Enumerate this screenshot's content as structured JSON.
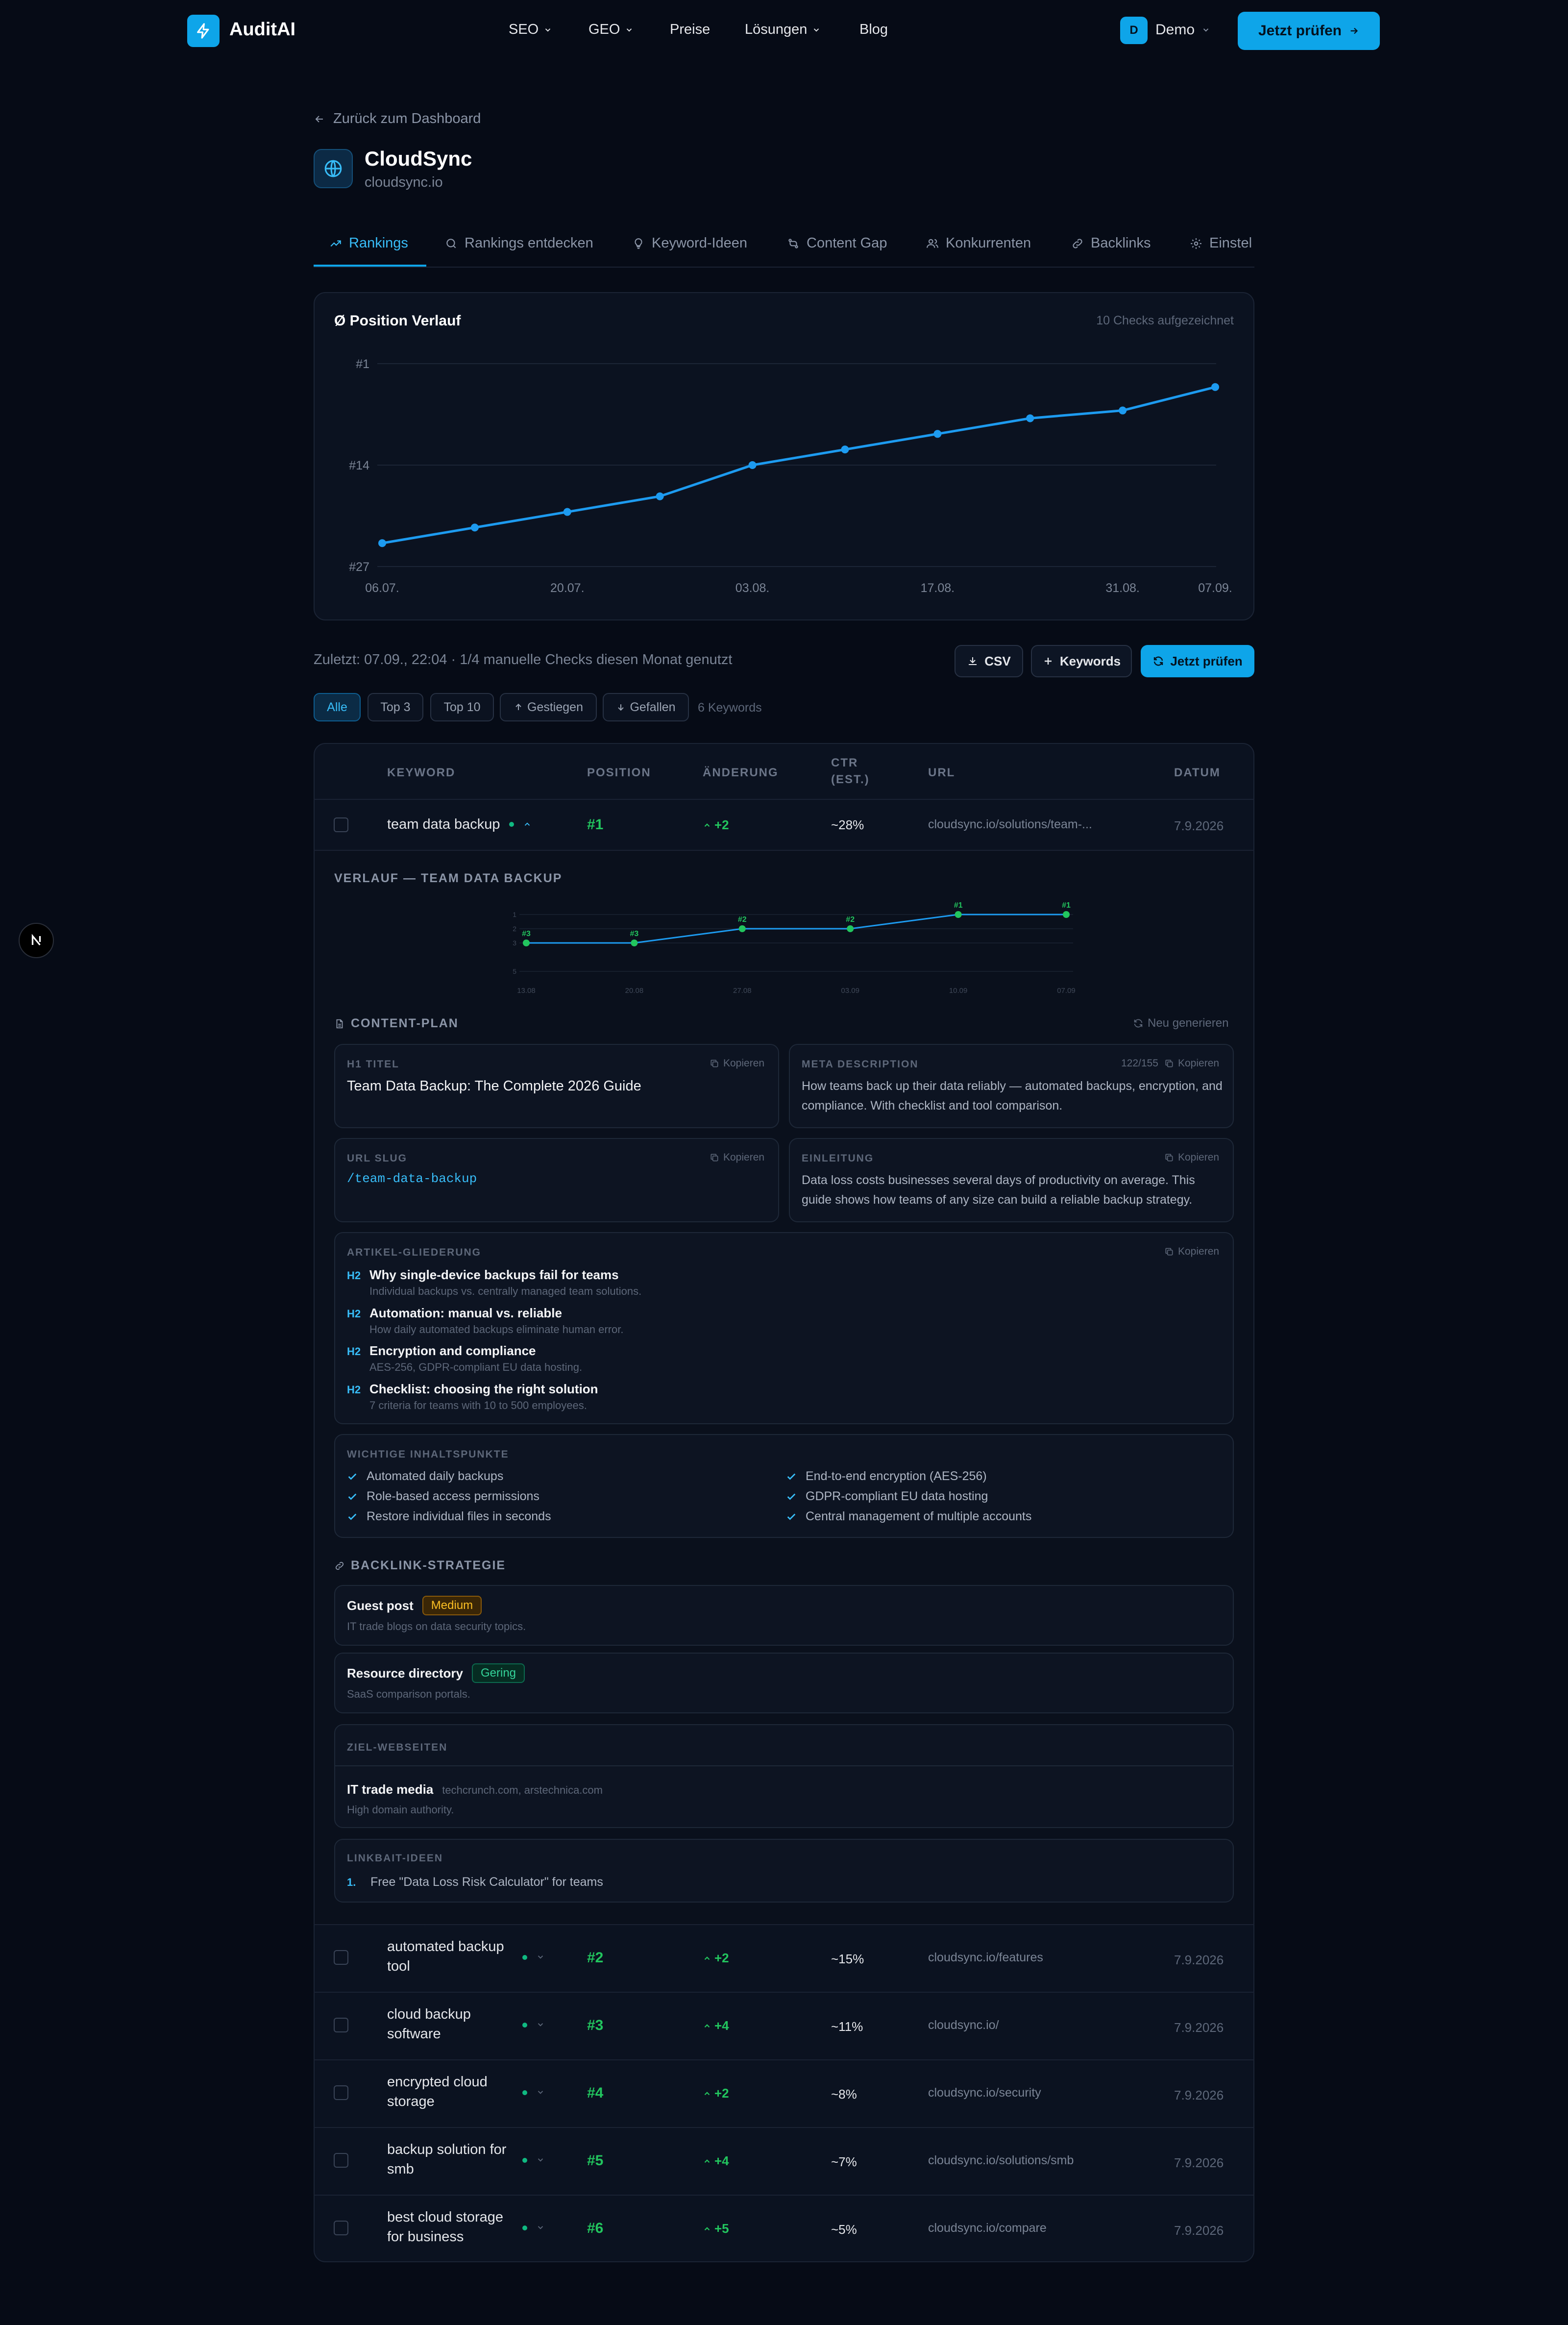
{
  "nav": {
    "brand": "AuditAI",
    "items": [
      "SEO",
      "GEO",
      "Preise",
      "Lösungen",
      "Blog"
    ],
    "user_initial": "D",
    "user_label": "Demo",
    "cta": "Jetzt prüfen"
  },
  "header": {
    "back": "Zurück zum Dashboard",
    "site_name": "CloudSync",
    "site_domain": "cloudsync.io"
  },
  "tabs": [
    "Rankings",
    "Rankings entdecken",
    "Keyword-Ideen",
    "Content Gap",
    "Konkurrenten",
    "Backlinks",
    "Einstel"
  ],
  "chart_data": [
    {
      "type": "line",
      "title": "Ø Position Verlauf",
      "note": "10 Checks aufgezeichnet",
      "x": [
        "06.07.",
        "13.07.",
        "20.07.",
        "27.07.",
        "03.08.",
        "10.08.",
        "17.08.",
        "24.08.",
        "31.08.",
        "07.09."
      ],
      "x_ticks": [
        "06.07.",
        "20.07.",
        "03.08.",
        "17.08.",
        "31.08.",
        "07.09."
      ],
      "y_ticks": [
        "#1",
        "#14",
        "#27"
      ],
      "values": [
        24,
        22,
        20,
        18,
        14,
        12,
        10,
        8,
        7,
        4
      ],
      "ylim": [
        1,
        27
      ],
      "y_inverted": true,
      "grid": true,
      "color": "#1d9bf0"
    },
    {
      "type": "line",
      "title": "VERLAUF — TEAM DATA BACKUP",
      "x": [
        "13.08",
        "20.08",
        "27.08",
        "03.09",
        "10.09",
        "07.09"
      ],
      "values": [
        3,
        3,
        2,
        2,
        1,
        1
      ],
      "labels": [
        "#3",
        "#3",
        "#2",
        "#2",
        "#1",
        "#1"
      ],
      "y_ticks": [
        "1",
        "2",
        "3",
        "5"
      ],
      "ylim": [
        1,
        5
      ],
      "y_inverted": true,
      "color": "#22c55e"
    }
  ],
  "toolbar": {
    "meta": "Zuletzt: 07.09., 22:04 · 1/4 manuelle Checks diesen Monat genutzt",
    "csv": "CSV",
    "keywords": "Keywords",
    "check": "Jetzt prüfen"
  },
  "filters": [
    "Alle",
    "Top 3",
    "Top 10",
    "Gestiegen",
    "Gefallen"
  ],
  "keyword_count": "6 Keywords",
  "table": {
    "headers": [
      "KEYWORD",
      "POSITION",
      "ÄNDERUNG",
      "CTR (EST.)",
      "URL",
      "DATUM"
    ],
    "rows": [
      {
        "keyword": "team data backup",
        "position": "#1",
        "change": "+2",
        "ctr": "~28%",
        "url": "cloudsync.io/solutions/team-...",
        "date": "7.9.2026"
      },
      {
        "keyword": "automated backup tool",
        "position": "#2",
        "change": "+2",
        "ctr": "~15%",
        "url": "cloudsync.io/features",
        "date": "7.9.2026"
      },
      {
        "keyword": "cloud backup software",
        "position": "#3",
        "change": "+4",
        "ctr": "~11%",
        "url": "cloudsync.io/",
        "date": "7.9.2026"
      },
      {
        "keyword": "encrypted cloud storage",
        "position": "#4",
        "change": "+2",
        "ctr": "~8%",
        "url": "cloudsync.io/security",
        "date": "7.9.2026"
      },
      {
        "keyword": "backup solution for smb",
        "position": "#5",
        "change": "+4",
        "ctr": "~7%",
        "url": "cloudsync.io/solutions/smb",
        "date": "7.9.2026"
      },
      {
        "keyword": "best cloud storage for business",
        "position": "#6",
        "change": "+5",
        "ctr": "~5%",
        "url": "cloudsync.io/compare",
        "date": "7.9.2026"
      }
    ]
  },
  "expanded": {
    "chart_title": "VERLAUF — TEAM DATA BACKUP",
    "content_plan": "CONTENT-PLAN",
    "regenerate": "Neu generieren",
    "copy": "Kopieren",
    "h1_label": "H1 TITEL",
    "h1_value": "Team Data Backup: The Complete 2026 Guide",
    "meta_label": "META DESCRIPTION",
    "meta_count": "122/155",
    "meta_value": "How teams back up their data reliably — automated backups, encryption, and compliance. With checklist and tool comparison.",
    "slug_label": "URL SLUG",
    "slug_value": "/team-data-backup",
    "intro_label": "EINLEITUNG",
    "intro_value": "Data loss costs businesses several days of productivity on average. This guide shows how teams of any size can build a reliable backup strategy.",
    "outline_label": "ARTIKEL-GLIEDERUNG",
    "outline": [
      {
        "tag": "H2",
        "title": "Why single-device backups fail for teams",
        "sub": "Individual backups vs. centrally managed team solutions."
      },
      {
        "tag": "H2",
        "title": "Automation: manual vs. reliable",
        "sub": "How daily automated backups eliminate human error."
      },
      {
        "tag": "H2",
        "title": "Encryption and compliance",
        "sub": "AES-256, GDPR-compliant EU data hosting."
      },
      {
        "tag": "H2",
        "title": "Checklist: choosing the right solution",
        "sub": "7 criteria for teams with 10 to 500 employees."
      }
    ],
    "points_label": "WICHTIGE INHALTSPUNKTE",
    "points": [
      "Automated daily backups",
      "End-to-end encryption (AES-256)",
      "Role-based access permissions",
      "GDPR-compliant EU data hosting",
      "Restore individual files in seconds",
      "Central management of multiple accounts"
    ],
    "backlink_title": "BACKLINK-STRATEGIE",
    "strategies": [
      {
        "name": "Guest post",
        "level": "Medium",
        "desc": "IT trade blogs on data security topics."
      },
      {
        "name": "Resource directory",
        "level": "Gering",
        "desc": "SaaS comparison portals."
      }
    ],
    "targets_label": "ZIEL-WEBSEITEN",
    "target_name": "IT trade media",
    "target_sites": "techcrunch.com, arstechnica.com",
    "target_desc": "High domain authority.",
    "linkbait_label": "LINKBAIT-IDEEN",
    "linkbait_num": "1.",
    "linkbait": "Free \"Data Loss Risk Calculator\" for teams"
  },
  "colors": {
    "accent": "#0ea5e9",
    "positive": "#22c55e",
    "medium": "#f59e0b",
    "low": "#10b981",
    "background": "#060b16"
  }
}
